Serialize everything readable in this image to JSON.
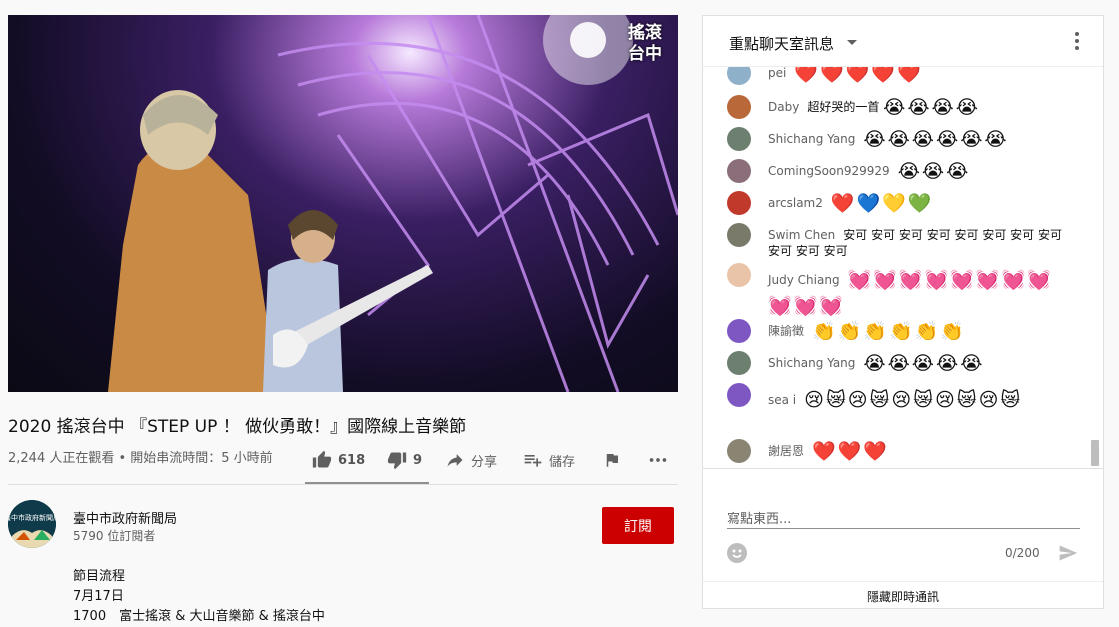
{
  "video": {
    "watermark": "搖滾台中",
    "title": "2020 搖滾台中 『STEP UP ！ 做伙勇敢！』國際線上音樂節",
    "meta": "2,244 人正在觀看 • 開始串流時間：5 小時前"
  },
  "actions": {
    "like_count": "618",
    "dislike_count": "9",
    "share_label": "分享",
    "save_label": "儲存"
  },
  "channel": {
    "name": "臺中市政府新聞局",
    "subscribers": "5790 位訂閱者",
    "subscribe_label": "訂閱",
    "avatar_text": "臺中市政府新聞局"
  },
  "description": {
    "line1": "節目流程",
    "line2": "7月17日",
    "line3": "1700　富士搖滾 & 大山音樂節 & 搖滾台中"
  },
  "chat": {
    "header_title": "重點聊天室訊息",
    "messages": [
      {
        "author": "pei",
        "text": "",
        "emoji": "❤️❤️❤️❤️❤️",
        "avatar_color": "#8fb0c9"
      },
      {
        "author": "Daby",
        "text": "超好哭的一首",
        "emoji": "😭😭😭😭",
        "avatar_color": "#b9683a"
      },
      {
        "author": "Shichang Yang",
        "text": "",
        "emoji": "😭😭😭😭😭😭",
        "avatar_color": "#6d7f6e"
      },
      {
        "author": "ComingSoon929929",
        "text": "",
        "emoji": "😭😭😭",
        "avatar_color": "#8a6f7a"
      },
      {
        "author": "arcslam2",
        "text": "",
        "emoji": "❤️💙💛💚",
        "avatar_color": "#c0392b"
      },
      {
        "author": "Swim Chen",
        "text": "安可 安可 安可 安可 安可 安可 安可 安可 安可 安可 安可",
        "emoji": "",
        "avatar_color": "#7a7a6a"
      },
      {
        "author": "Judy Chiang",
        "text": "",
        "emoji": "💓💓💓💓💓💓💓💓💓💓💓",
        "avatar_color": "#e9c4a8"
      },
      {
        "author": "陳諭徵",
        "text": "",
        "emoji": "👏👏👏👏👏👏",
        "avatar_color": "#7e57c2"
      },
      {
        "author": "Shichang Yang",
        "text": "",
        "emoji": "😭😭😭😭😭",
        "avatar_color": "#6d7f6e"
      },
      {
        "author": "sea i",
        "text": "",
        "emoji": "😢😿😢😿😢😿😢😿😢😿",
        "avatar_color": "#7e57c2"
      },
      {
        "author": "謝居恩",
        "text": "",
        "emoji": "❤️❤️❤️",
        "avatar_color": "#8a8473"
      }
    ],
    "input_placeholder": "寫點東西...",
    "char_count": "0/200",
    "hide_label": "隱藏即時通訊"
  },
  "icons": {
    "like": "thumbs-up-icon",
    "dislike": "thumbs-down-icon",
    "share": "share-arrow-icon",
    "save": "playlist-add-icon",
    "flag": "flag-icon",
    "more": "more-horizontal-icon",
    "caret": "caret-down-icon",
    "kebab": "more-vertical-icon",
    "emoji": "smile-icon",
    "send": "send-icon"
  },
  "colors": {
    "subscribe": "#cc0000",
    "accent_gray": "#606060"
  }
}
